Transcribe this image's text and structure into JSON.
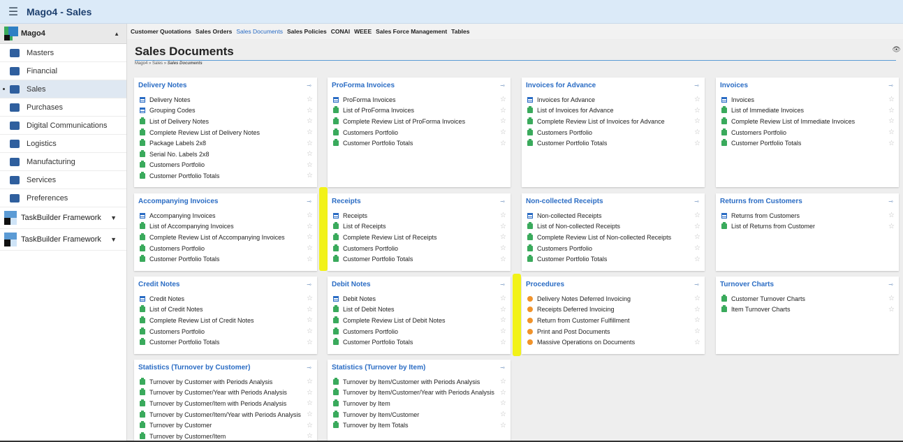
{
  "app": {
    "title": "Mago4 - Sales"
  },
  "sidebar": {
    "header": "Mago4",
    "items": [
      {
        "label": "Masters",
        "icon": "masters-icon",
        "color": "#2f5f9e"
      },
      {
        "label": "Financial",
        "icon": "financial-icon",
        "color": "#2f5f9e"
      },
      {
        "label": "Sales",
        "icon": "sales-icon",
        "color": "#2f5f9e",
        "active": true
      },
      {
        "label": "Purchases",
        "icon": "purchases-icon",
        "color": "#2f5f9e"
      },
      {
        "label": "Digital Communications",
        "icon": "digital-communications-icon",
        "color": "#2f5f9e"
      },
      {
        "label": "Logistics",
        "icon": "logistics-icon",
        "color": "#2f5f9e"
      },
      {
        "label": "Manufacturing",
        "icon": "manufacturing-icon",
        "color": "#2f5f9e"
      },
      {
        "label": "Services",
        "icon": "services-icon",
        "color": "#2f5f9e"
      },
      {
        "label": "Preferences",
        "icon": "preferences-icon",
        "color": "#2f5f9e"
      }
    ],
    "frameworks": [
      "TaskBuilder Framework",
      "TaskBuilder Framework"
    ]
  },
  "topnav": [
    {
      "label": "Customer Quotations"
    },
    {
      "label": "Sales Orders"
    },
    {
      "label": "Sales Documents",
      "active": true
    },
    {
      "label": "Sales Policies"
    },
    {
      "label": "CONAI"
    },
    {
      "label": "WEEE"
    },
    {
      "label": "Sales Force Management"
    },
    {
      "label": "Tables"
    }
  ],
  "page": {
    "title": "Sales Documents",
    "breadcrumb": {
      "prefix": "Mago4 » Sales » ",
      "current": "Sales Documents"
    }
  },
  "colors": {
    "accent": "#2a6cc4",
    "report": "#3aaa5c",
    "procedure": "#f0932b",
    "highlight": "#f2f200"
  },
  "cards": [
    {
      "title": "Delivery Notes",
      "items": [
        {
          "label": "Delivery Notes",
          "type": "doc"
        },
        {
          "label": "Grouping Codes",
          "type": "doc"
        },
        {
          "label": "List of Delivery Notes",
          "type": "rep"
        },
        {
          "label": "Complete Review List of Delivery Notes",
          "type": "rep"
        },
        {
          "label": "Package Labels 2x8",
          "type": "rep"
        },
        {
          "label": "Serial No. Labels 2x8",
          "type": "rep"
        },
        {
          "label": "Customers Portfolio",
          "type": "rep"
        },
        {
          "label": "Customer Portfolio Totals",
          "type": "rep"
        }
      ]
    },
    {
      "title": "ProForma Invoices",
      "items": [
        {
          "label": "ProForma Invoices",
          "type": "doc"
        },
        {
          "label": "List of ProForma Invoices",
          "type": "rep"
        },
        {
          "label": "Complete Review List of ProForma Invoices",
          "type": "rep"
        },
        {
          "label": "Customers Portfolio",
          "type": "rep"
        },
        {
          "label": "Customer Portfolio Totals",
          "type": "rep"
        }
      ]
    },
    {
      "title": "Invoices for Advance",
      "items": [
        {
          "label": "Invoices for Advance",
          "type": "doc"
        },
        {
          "label": "List of Invoices for Advance",
          "type": "rep"
        },
        {
          "label": "Complete Review List of Invoices for Advance",
          "type": "rep"
        },
        {
          "label": "Customers Portfolio",
          "type": "rep"
        },
        {
          "label": "Customer Portfolio Totals",
          "type": "rep"
        }
      ]
    },
    {
      "title": "Invoices",
      "items": [
        {
          "label": "Invoices",
          "type": "doc"
        },
        {
          "label": "List of Immediate Invoices",
          "type": "rep"
        },
        {
          "label": "Complete Review List of Immediate Invoices",
          "type": "rep"
        },
        {
          "label": "Customers Portfolio",
          "type": "rep"
        },
        {
          "label": "Customer Portfolio Totals",
          "type": "rep"
        }
      ]
    },
    {
      "title": "Accompanying Invoices",
      "items": [
        {
          "label": "Accompanying Invoices",
          "type": "doc"
        },
        {
          "label": "List of Accompanying Invoices",
          "type": "rep"
        },
        {
          "label": "Complete Review List of Accompanying Invoices",
          "type": "rep"
        },
        {
          "label": "Customers Portfolio",
          "type": "rep"
        },
        {
          "label": "Customer Portfolio Totals",
          "type": "rep"
        }
      ]
    },
    {
      "title": "Receipts",
      "items": [
        {
          "label": "Receipts",
          "type": "doc"
        },
        {
          "label": "List of Receipts",
          "type": "rep"
        },
        {
          "label": "Complete Review List of Receipts",
          "type": "rep"
        },
        {
          "label": "Customers Portfolio",
          "type": "rep"
        },
        {
          "label": "Customer Portfolio Totals",
          "type": "rep"
        }
      ]
    },
    {
      "title": "Non-collected Receipts",
      "items": [
        {
          "label": "Non-collected Receipts",
          "type": "doc"
        },
        {
          "label": "List of Non-collected Receipts",
          "type": "rep"
        },
        {
          "label": "Complete Review List of Non-collected Receipts",
          "type": "rep"
        },
        {
          "label": "Customers Portfolio",
          "type": "rep"
        },
        {
          "label": "Customer Portfolio Totals",
          "type": "rep"
        }
      ]
    },
    {
      "title": "Returns from Customers",
      "items": [
        {
          "label": "Returns from Customers",
          "type": "doc"
        },
        {
          "label": "List of Returns from Customer",
          "type": "rep"
        }
      ]
    },
    {
      "title": "Credit Notes",
      "items": [
        {
          "label": "Credit Notes",
          "type": "doc"
        },
        {
          "label": "List of Credit Notes",
          "type": "rep"
        },
        {
          "label": "Complete Review List of Credit Notes",
          "type": "rep"
        },
        {
          "label": "Customers Portfolio",
          "type": "rep"
        },
        {
          "label": "Customer Portfolio Totals",
          "type": "rep"
        }
      ]
    },
    {
      "title": "Debit Notes",
      "items": [
        {
          "label": "Debit Notes",
          "type": "doc"
        },
        {
          "label": "List of Debit Notes",
          "type": "rep"
        },
        {
          "label": "Complete Review List of Debit Notes",
          "type": "rep"
        },
        {
          "label": "Customers Portfolio",
          "type": "rep"
        },
        {
          "label": "Customer Portfolio Totals",
          "type": "rep"
        }
      ]
    },
    {
      "title": "Procedures",
      "items": [
        {
          "label": "Delivery Notes Deferred Invoicing",
          "type": "proc"
        },
        {
          "label": "Receipts Deferred Invoicing",
          "type": "proc"
        },
        {
          "label": "Return from Customer Fulfillment",
          "type": "proc"
        },
        {
          "label": "Print and Post Documents",
          "type": "proc"
        },
        {
          "label": "Massive Operations on Documents",
          "type": "proc"
        }
      ]
    },
    {
      "title": "Turnover Charts",
      "items": [
        {
          "label": "Customer Turnover Charts",
          "type": "rep"
        },
        {
          "label": "Item Turnover Charts",
          "type": "rep"
        }
      ]
    },
    {
      "title": "Statistics (Turnover by Customer)",
      "items": [
        {
          "label": "Turnover by Customer with Periods Analysis",
          "type": "rep"
        },
        {
          "label": "Turnover by Customer/Year with Periods Analysis",
          "type": "rep"
        },
        {
          "label": "Turnover by Customer/Item with Periods Analysis",
          "type": "rep"
        },
        {
          "label": "Turnover by Customer/Item/Year with Periods Analysis",
          "type": "rep"
        },
        {
          "label": "Turnover by Customer",
          "type": "rep"
        },
        {
          "label": "Turnover by Customer/Item",
          "type": "rep"
        }
      ]
    },
    {
      "title": "Statistics (Turnover by Item)",
      "items": [
        {
          "label": "Turnover by Item/Customer with Periods Analysis",
          "type": "rep"
        },
        {
          "label": "Turnover by Item/Customer/Year with Periods Analysis",
          "type": "rep"
        },
        {
          "label": "Turnover by Item",
          "type": "rep"
        },
        {
          "label": "Turnover by Item/Customer",
          "type": "rep"
        },
        {
          "label": "Turnover by Item Totals",
          "type": "rep"
        }
      ]
    }
  ]
}
